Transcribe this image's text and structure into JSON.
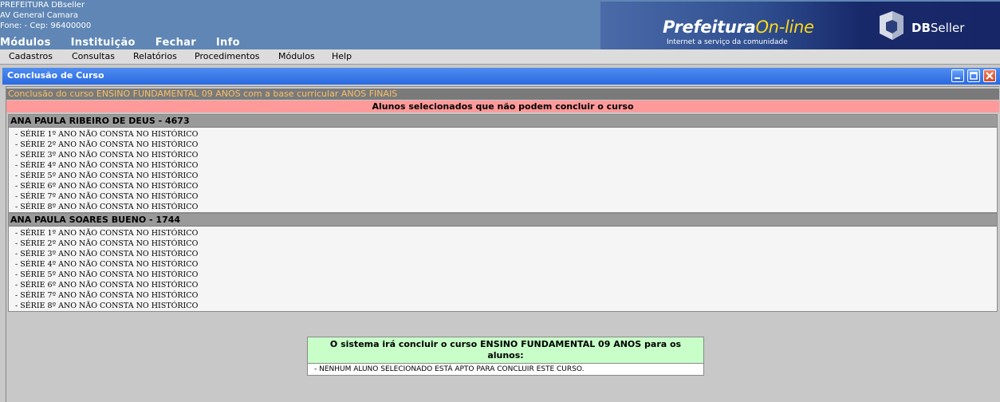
{
  "header": {
    "org_name": "PREFEITURA DBseller",
    "address": "AV General Camara",
    "phone_line": "Fone:   -  Cep: 96400000",
    "nav": [
      "Módulos",
      "Instituição",
      "Fechar",
      "Info"
    ],
    "brand_main": "Prefeitura",
    "brand_accent": "On-line",
    "tagline": "Internet a serviço da comunidade",
    "vendor_bold": "DB",
    "vendor_rest": "Seller"
  },
  "menubar": [
    "Cadastros",
    "Consultas",
    "Relatórios",
    "Procedimentos",
    "Módulos",
    "Help"
  ],
  "window": {
    "title": "Conclusão de Curso",
    "course_line": "Conclusão do curso ENSINO FUNDAMENTAL 09 ANOS com a base curricular ANOS FINAIS",
    "warning": "Alunos selecionados que não podem concluir o curso"
  },
  "students": [
    {
      "name": "ANA PAULA RIBEIRO DE DEUS - 4673",
      "issues": [
        "- SÉRIE 1º ANO NÃO CONSTA NO HISTÓRICO",
        "- SÉRIE 2º ANO NÃO CONSTA NO HISTÓRICO",
        "- SÉRIE 3º ANO NÃO CONSTA NO HISTÓRICO",
        "- SÉRIE 4º ANO NÃO CONSTA NO HISTÓRICO",
        "- SÉRIE 5º ANO NÃO CONSTA NO HISTÓRICO",
        "- SÉRIE 6º ANO NÃO CONSTA NO HISTÓRICO",
        "- SÉRIE 7º ANO NÃO CONSTA NO HISTÓRICO",
        "- SÉRIE 8º ANO NÃO CONSTA NO HISTÓRICO"
      ]
    },
    {
      "name": "ANA PAULA SOARES BUENO - 1744",
      "issues": [
        "- SÉRIE 1º ANO NÃO CONSTA NO HISTÓRICO",
        "- SÉRIE 2º ANO NÃO CONSTA NO HISTÓRICO",
        "- SÉRIE 3º ANO NÃO CONSTA NO HISTÓRICO",
        "- SÉRIE 4º ANO NÃO CONSTA NO HISTÓRICO",
        "- SÉRIE 5º ANO NÃO CONSTA NO HISTÓRICO",
        "- SÉRIE 6º ANO NÃO CONSTA NO HISTÓRICO",
        "- SÉRIE 7º ANO NÃO CONSTA NO HISTÓRICO",
        "- SÉRIE 8º ANO NÃO CONSTA NO HISTÓRICO"
      ]
    }
  ],
  "result": {
    "heading": "O sistema irá concluir o curso ENSINO FUNDAMENTAL 09 ANOS para os alunos:",
    "message": "- NENHUM ALUNO SELECIONADO ESTÁ APTO PARA CONCLUIR ESTE CURSO."
  },
  "icons": {
    "minimize": "minimize-icon",
    "maximize": "maximize-icon",
    "close": "close-icon",
    "vendor_logo": "dbseller-logo-icon"
  },
  "colors": {
    "header_bg": "#5f86b4",
    "titlebar": "#2a6ae0",
    "warning_bg": "#ff9a9a",
    "course_text": "#f6c06a",
    "result_head_bg": "#c8ffc8",
    "brand_accent": "#ffd81a"
  }
}
